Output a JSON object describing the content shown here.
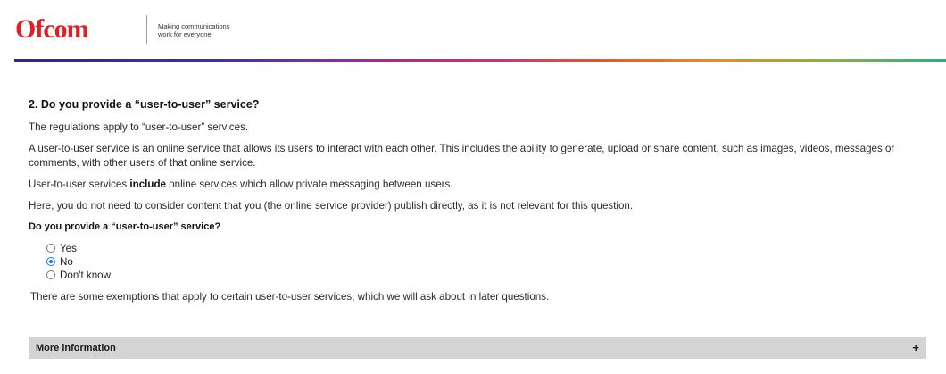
{
  "header": {
    "logo_text": "Ofcom",
    "tagline_line1": "Making communications",
    "tagline_line2": "work for everyone"
  },
  "question": {
    "heading": "2. Do you provide a “user-to-user” service?",
    "para1": "The regulations apply to “user-to-user” services.",
    "para2": "A user-to-user service is an online service that allows its users to interact with each other. This includes the ability to generate, upload or share content, such as images, videos, messages or comments, with other users of that online service.",
    "para3_before": "User-to-user services ",
    "para3_bold": "include",
    "para3_after": " online services which allow private messaging between users.",
    "para4": "Here, you do not need to consider content that you (the online service provider) publish directly, as it is not relevant for this question.",
    "sub_question": "Do you provide a “user-to-user” service?",
    "options": [
      {
        "label": "Yes",
        "checked": false
      },
      {
        "label": "No",
        "checked": true
      },
      {
        "label": "Don't know",
        "checked": false
      }
    ],
    "exemptions": "There are some exemptions that apply to certain user-to-user services, which we will ask about in later questions."
  },
  "accordion": {
    "title": "More information",
    "toggle_symbol": "+"
  },
  "colors": {
    "brand_red": "#d8232a",
    "radio_selected": "#1a73e8",
    "accordion_bg": "#d4d4d4"
  }
}
